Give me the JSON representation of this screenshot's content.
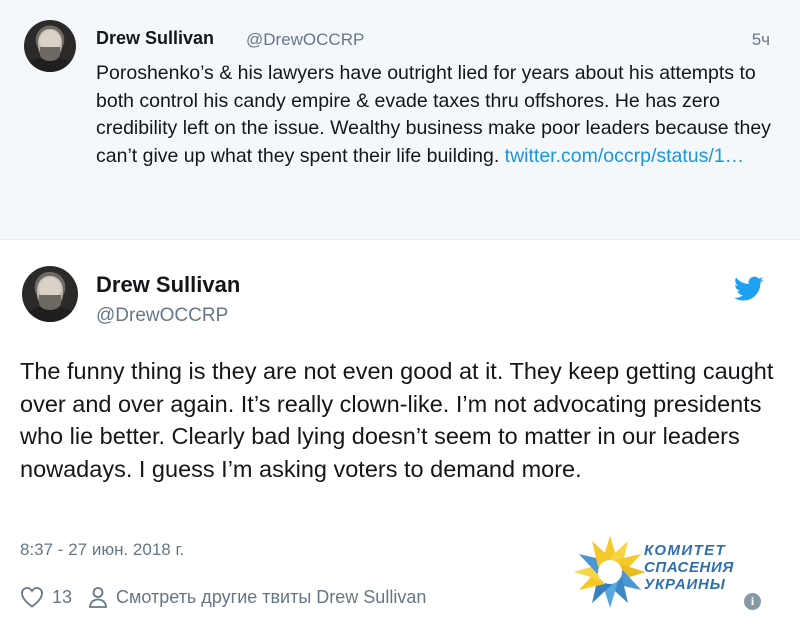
{
  "parent_tweet": {
    "author_name": "Drew Sullivan",
    "author_handle": "@DrewOCCRP",
    "time": "5ч",
    "text": "Poroshenko’s & his lawyers have outright lied for years about his attempts to both control his candy empire & evade taxes thru offshores. He has zero credibility left on the issue. Wealthy business make poor leaders because they can’t give up what they spent their life building. ",
    "link": "twitter.com/occrp/status/1…"
  },
  "tweet": {
    "author_name": "Drew Sullivan",
    "author_handle": "@DrewOCCRP",
    "text": "The funny thing is they are not even good at it. They keep getting caught over and over again. It’s really clown-like. I’m not advocating presidents who lie better. Clearly bad lying doesn’t seem to matter in our leaders nowadays. I guess I’m asking voters to demand more.",
    "timestamp": "8:37 - 27 июн. 2018 г.",
    "like_count": "13",
    "more_tweets_label": "Смотреть другие твиты Drew Sullivan"
  },
  "watermark": {
    "line1": "КОМИТЕТ",
    "line2": "СПАСЕНИЯ",
    "line3": "УКРАИНЫ"
  },
  "icons": {
    "bird": "twitter-bird-icon",
    "heart": "heart-icon",
    "person": "person-icon",
    "info": "info-icon"
  },
  "colors": {
    "link": "#1b95e0",
    "secondary_text": "#657786",
    "parent_background": "#f5f8fa",
    "twitter_blue": "#1da1f2"
  }
}
